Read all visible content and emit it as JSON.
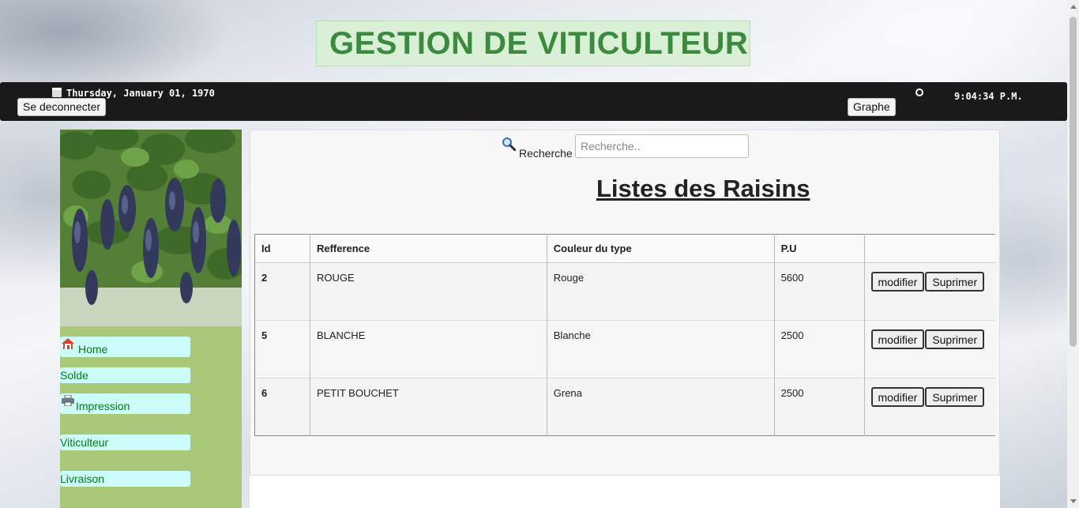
{
  "header": {
    "title": "GESTION DE VITICULTEUR",
    "date": "Thursday, January 01, 1970",
    "time": "9:04:34 P.M.",
    "logout_label": "Se deconnecter",
    "graph_label": "Graphe"
  },
  "sidebar": {
    "items": [
      {
        "label": "Home",
        "icon": "house-icon"
      },
      {
        "label": "Solde"
      },
      {
        "label": "Impression",
        "icon": "printer-icon"
      },
      {
        "label": "Viticulteur"
      },
      {
        "label": "Livraison"
      }
    ]
  },
  "search": {
    "label": "Recherche",
    "placeholder": "Recherche.."
  },
  "main": {
    "title": "Listes des Raisins",
    "columns": [
      "Id",
      "Refference",
      "Couleur du type",
      "P.U",
      ""
    ],
    "rows": [
      {
        "id": "2",
        "reference": "ROUGE",
        "couleur": "Rouge",
        "pu": "5600"
      },
      {
        "id": "5",
        "reference": "BLANCHE",
        "couleur": "Blanche",
        "pu": "2500"
      },
      {
        "id": "6",
        "reference": "PETIT BOUCHET",
        "couleur": "Grena",
        "pu": "2500"
      }
    ],
    "edit_label": "modifier",
    "delete_label": "Suprimer"
  },
  "colors": {
    "title_green": "#3c8a3f",
    "sidebar_green": "#a9c878",
    "nav_bg": "#ccfcfa",
    "nav_text": "#0a7a1a",
    "topbar": "#1a1a1a"
  }
}
